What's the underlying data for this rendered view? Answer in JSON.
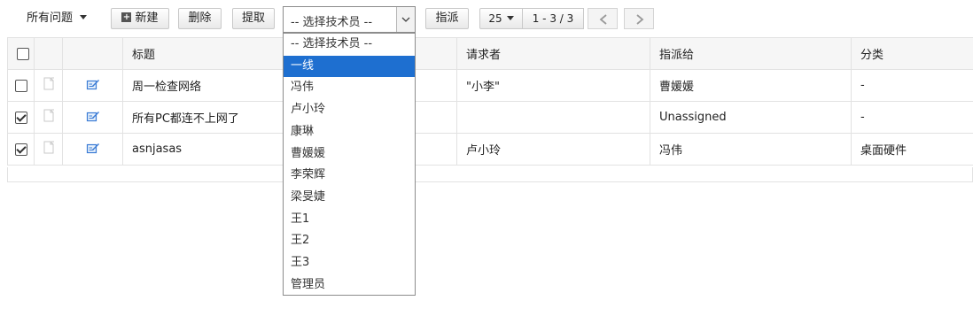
{
  "toolbar": {
    "view_label": "所有问题",
    "new_label": "新建",
    "delete_label": "删除",
    "pickup_label": "提取",
    "tech_select_value": "-- 选择技术员 --",
    "assign_label": "指派",
    "page_size": "25",
    "page_range": "1 - 3 / 3"
  },
  "icons": {
    "prev": "chevron-left-icon",
    "next": "chevron-right-icon",
    "new": "plus-square-icon",
    "note": "note-icon",
    "edit": "edit-icon"
  },
  "table": {
    "columns": [
      "标题",
      "请求者",
      "指派给",
      "分类"
    ],
    "rows": [
      {
        "checked": false,
        "title": "周一检查网络",
        "requester": "\"小李\"",
        "assignee": "曹媛媛",
        "category": "-"
      },
      {
        "checked": true,
        "title": "所有PC都连不上网了",
        "requester": "",
        "assignee": "Unassigned",
        "category": "-"
      },
      {
        "checked": true,
        "title": "asnjasas",
        "requester": "卢小玲",
        "assignee": "冯伟",
        "category": "桌面硬件"
      }
    ]
  },
  "dropdown": {
    "highlighted_index": 1,
    "options": [
      "-- 选择技术员 --",
      "一线",
      "冯伟",
      "卢小玲",
      "康琳",
      "曹媛媛",
      "李荣辉",
      "梁旻婕",
      "王1",
      "王2",
      "王3",
      "管理员"
    ]
  },
  "colors": {
    "highlight": "#1e6fd0",
    "edit_icon": "#3a7bd5"
  }
}
